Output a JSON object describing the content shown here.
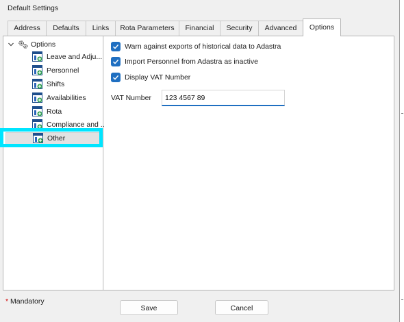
{
  "window": {
    "title": "Default Settings"
  },
  "tabs": [
    {
      "label": "Address"
    },
    {
      "label": "Defaults"
    },
    {
      "label": "Links"
    },
    {
      "label": "Rota Parameters"
    },
    {
      "label": "Financial"
    },
    {
      "label": "Security"
    },
    {
      "label": "Advanced"
    },
    {
      "label": "Options",
      "active": true
    }
  ],
  "tree": {
    "root": {
      "label": "Options",
      "icon": "gear-icon",
      "expanded": true
    },
    "items": [
      {
        "label": "Leave and Adju...",
        "icon": "settings-node-icon"
      },
      {
        "label": "Personnel",
        "icon": "settings-node-icon"
      },
      {
        "label": "Shifts",
        "icon": "settings-node-icon"
      },
      {
        "label": "Availabilities",
        "icon": "settings-node-icon"
      },
      {
        "label": "Rota",
        "icon": "settings-node-icon"
      },
      {
        "label": "Compliance and ...",
        "icon": "settings-node-icon"
      },
      {
        "label": "Other",
        "icon": "settings-node-icon",
        "selected": true
      }
    ]
  },
  "options": {
    "checkboxes": [
      {
        "label": "Warn against exports of historical data to Adastra",
        "checked": true
      },
      {
        "label": "Import Personnel from Adastra as inactive",
        "checked": true
      },
      {
        "label": "Display VAT Number",
        "checked": true
      }
    ],
    "vat": {
      "label": "VAT Number",
      "value": "123 4567 89"
    }
  },
  "footer": {
    "mandatory_star": "*",
    "mandatory_label": "Mandatory",
    "save_label": "Save",
    "cancel_label": "Cancel"
  },
  "colors": {
    "accent": "#1f6fc1",
    "highlight": "#00e5ff",
    "mandatory": "#d10000"
  }
}
